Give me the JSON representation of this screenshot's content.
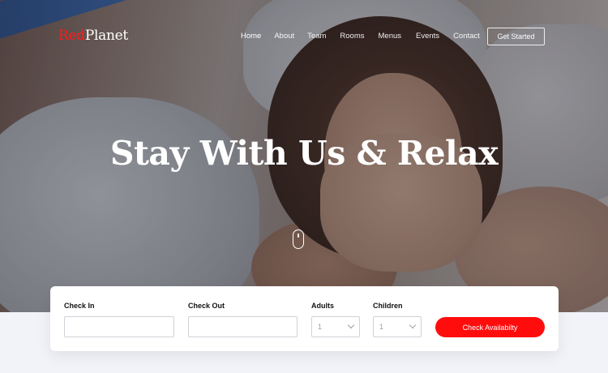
{
  "brand": {
    "logo_prefix": "Red",
    "logo_suffix": "Planet",
    "accent_color": "#ff1a1a"
  },
  "nav": {
    "items": [
      {
        "label": "Home",
        "active": true
      },
      {
        "label": "About"
      },
      {
        "label": "Team"
      },
      {
        "label": "Rooms"
      },
      {
        "label": "Menus"
      },
      {
        "label": "Events"
      },
      {
        "label": "Contact"
      }
    ],
    "cta_label": "Get Started"
  },
  "hero": {
    "headline": "Stay With Us & Relax"
  },
  "booking": {
    "check_in_label": "Check In",
    "check_in_value": "",
    "check_out_label": "Check Out",
    "check_out_value": "",
    "adults_label": "Adults",
    "adults_value": "1",
    "children_label": "Children",
    "children_value": "1",
    "submit_label": "Check Availabilty",
    "submit_color": "#ff0d0d"
  }
}
